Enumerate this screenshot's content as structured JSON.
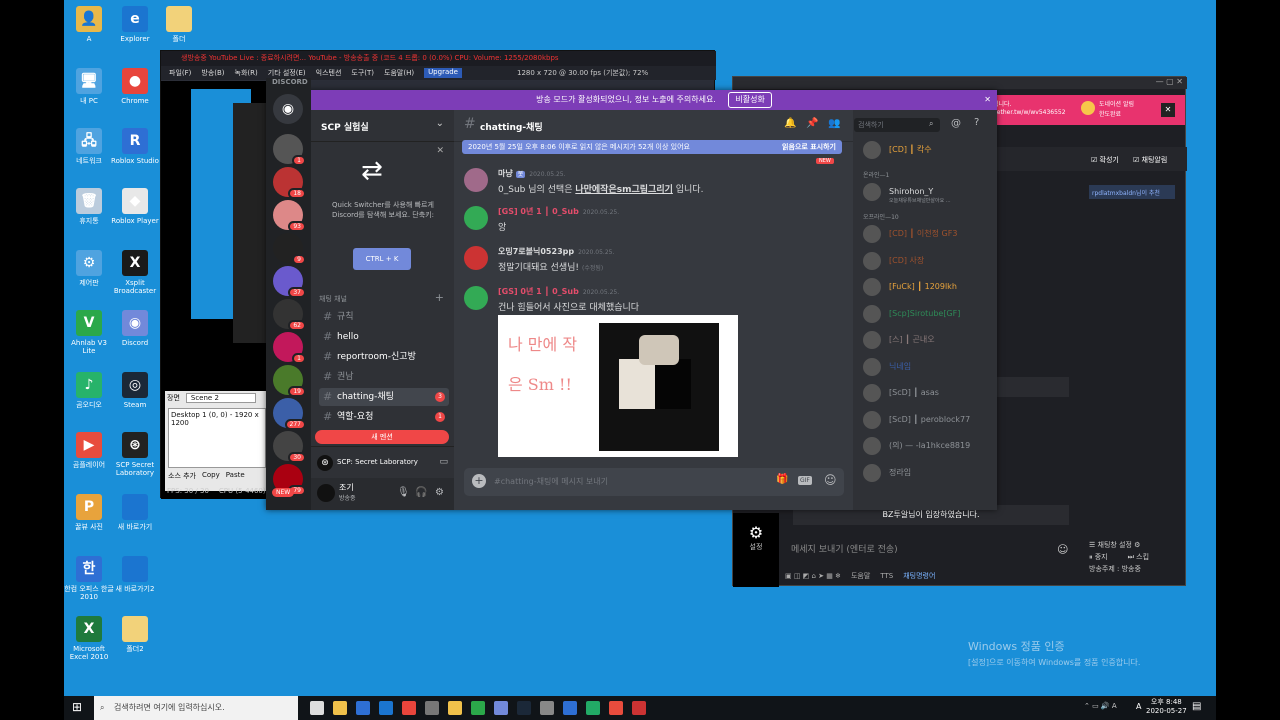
{
  "desktop_icons": [
    {
      "label": "A",
      "color": "#e8b84a",
      "glyph": "👤"
    },
    {
      "label": "Explorer",
      "color": "#1b75d0",
      "glyph": "e"
    },
    {
      "label": "폴더",
      "color": "#f2d27a",
      "glyph": ""
    },
    {
      "label": "내 PC",
      "color": "#4fa3e0",
      "glyph": "🖥"
    },
    {
      "label": "Chrome",
      "color": "#e8453c",
      "glyph": "●"
    },
    {
      "label": "네트워크",
      "color": "#4fa3e0",
      "glyph": "🖧"
    },
    {
      "label": "Roblox Studio",
      "color": "#2e6fd4",
      "glyph": "R"
    },
    {
      "label": "휴지통",
      "color": "#bcd",
      "glyph": "🗑"
    },
    {
      "label": "Roblox Player",
      "color": "#e8e8e8",
      "glyph": "◆"
    },
    {
      "label": "제어판",
      "color": "#4fa3e0",
      "glyph": "⚙"
    },
    {
      "label": "Xsplit Broadcaster",
      "color": "#1a1a1a",
      "glyph": "X"
    },
    {
      "label": "Ahnlab V3 Lite",
      "color": "#2ba84a",
      "glyph": "V"
    },
    {
      "label": "Discord",
      "color": "#7289da",
      "glyph": "◉"
    },
    {
      "label": "곰오디오",
      "color": "#27b36a",
      "glyph": "♪"
    },
    {
      "label": "Steam",
      "color": "#1b2838",
      "glyph": "◎"
    },
    {
      "label": "곰플레이어",
      "color": "#e84c3d",
      "glyph": "▶"
    },
    {
      "label": "SCP Secret Laboratory",
      "color": "#222",
      "glyph": "⊛"
    },
    {
      "label": "꿀뷰 사진",
      "color": "#e8a33c",
      "glyph": "P"
    },
    {
      "label": "새 바로가기",
      "color": "#1b75d0",
      "glyph": ""
    },
    {
      "label": "한컴 오피스 한글 2010",
      "color": "#2e6fd4",
      "glyph": "한"
    },
    {
      "label": "새 바로가기2",
      "color": "#1b75d0",
      "glyph": ""
    },
    {
      "label": "Microsoft Excel 2010",
      "color": "#1f7a3d",
      "glyph": "X"
    },
    {
      "label": "폴더2",
      "color": "#f2d27a",
      "glyph": ""
    }
  ],
  "obs": {
    "title": "생방송중   YouTube Live : 종료하시려면...   YouTube - 방송송출 중 (코드 4 드롭: 0 (0.0%)  CPU:  Volume: 1255/2080kbps",
    "menu": [
      "파일(F)",
      "방송(B)",
      "녹화(R)",
      "기타 설정(E)",
      "익스텐션",
      "도구(T)",
      "도움말(H)",
      "Upgrade"
    ],
    "resolution": "1280 x 720 @ 30.00 fps (기본값); 72%",
    "scene_label": "장면",
    "scene_name": "Scene 2",
    "source": "Desktop 1 (0, 0) - 1920 x 1200",
    "add_source": "소스 추가",
    "copy": "Copy",
    "paste": "Paste",
    "fps": "FPS: 30 / 30",
    "cpu": "CPU (5-4460)"
  },
  "discord": {
    "wordmark": "DISCORD",
    "banner": "방송 모드가 활성화되었으니, 정보 노출에 주의하세요.",
    "banner_button": "비활성화",
    "server_name": "SCP 실험실",
    "quick_switcher": "Quick Switcher를 사용해 빠르게 Discord를 탐색해 보세요. 단축키:",
    "shortcut": "CTRL + K",
    "category": "채팅 채널",
    "channels": [
      {
        "name": "규칙",
        "state": "read"
      },
      {
        "name": "hello",
        "state": "unread"
      },
      {
        "name": "reportroom-신고방",
        "state": "unread"
      },
      {
        "name": "권남",
        "state": "read"
      },
      {
        "name": "chatting-채팅",
        "state": "active",
        "badge": "3"
      },
      {
        "name": "역할-요청",
        "state": "unread",
        "badge": "1"
      }
    ],
    "new_mentions": "새 멘션",
    "voice_server": "SCP: Secret Laboratory",
    "user_name": "조기",
    "user_status": "방송중",
    "guild_badges": [
      "1",
      "18",
      "93",
      "9",
      "37",
      "62",
      "1",
      "19",
      "277",
      "30",
      "79"
    ],
    "guild_new": "NEW",
    "channel_title": "chatting-채팅",
    "search_placeholder": "검색하기",
    "unread_bar": "2020년 5월 25일 오후 8:06 이후로 읽지 않은 메시지가 52개 이상 있어요",
    "mark_read": "읽음으로 표시하기",
    "new_label": "NEW",
    "messages": [
      {
        "author": "마냥",
        "tag": "봇",
        "time": "2020.05.25.",
        "text_pre": "0_Sub 님의 선택은 ",
        "text_bold": "나만에작은sm그림그리기",
        "text_post": " 입니다.",
        "color": "#dcddde",
        "avatar": "#a06a8a"
      },
      {
        "author": "[GS] 0년 1 ┃ 0_Sub",
        "time": "2020.05.25.",
        "text": "앙",
        "color": "#e44d6b",
        "avatar": "#3a5"
      },
      {
        "author": "오밍7로볼닉0523pp",
        "time": "2020.05.25.",
        "text": "정말기대돼요 선생님!",
        "edited": "(수정됨)",
        "color": "#dcddde",
        "avatar": "#c33"
      },
      {
        "author": "[GS] 0년 1 ┃ 0_Sub",
        "time": "2020.05.25.",
        "text": "건나 힘들어서 사진으로 대체했습니다",
        "color": "#e44d6b",
        "avatar": "#3a5"
      }
    ],
    "drawing_text": "나 만에 작은 Sm !!",
    "input_placeholder": "#chatting-채팅에 메시지 보내기",
    "gif": "GIF",
    "member_sections": [
      {
        "title": "",
        "members": [
          {
            "name": "[CD] ┃ 칵수",
            "color": "#e8a33c"
          }
        ]
      },
      {
        "title": "온라인—1",
        "members": [
          {
            "name": "Shirohon_Y",
            "sub": "오늘채유튜브채널만살아요 ...",
            "color": "#dcddde"
          }
        ]
      },
      {
        "title": "오프라인—10",
        "members": [
          {
            "name": "[CD] ┃ 이천정 GF3",
            "color": "#a0522d"
          },
          {
            "name": "[CD] 사장",
            "color": "#a0522d"
          },
          {
            "name": "[FuCk] ┃ 1209lkh",
            "color": "#e8a33c"
          },
          {
            "name": "[Scp]Sirotube[GF]",
            "color": "#2e8b57"
          },
          {
            "name": "[스] ┃ 곤내오",
            "color": "#8a7a7a"
          },
          {
            "name": "닉네임",
            "color": "#3b5fa8"
          },
          {
            "name": "[ScD] ┃ asas",
            "color": "#8e9297"
          },
          {
            "name": "[ScD] ┃ peroblock77",
            "color": "#8e9297"
          },
          {
            "name": "(의) — -la1hkce8819",
            "color": "#8e9297"
          },
          {
            "name": "정라임",
            "color": "#8e9297"
          }
        ]
      }
    ]
  },
  "stream_panel": {
    "url": "gether.tw/w/wv5436552",
    "donate_label": "도네이션 알림",
    "donate_sub": "한도완료",
    "close": "✕",
    "tip": "됩니다.",
    "options": [
      "확성기",
      "채팅알림"
    ],
    "user_chip": "rpdlatmxbaldn님이 추천",
    "join_msg": "BZ투알님이 입장하였습니다.",
    "settings": "설정",
    "input_placeholder": "메세지 보내기 (엔터로 전송)",
    "chat_settings": "채팅창 설정",
    "stop": "중지",
    "skip": "스킵",
    "stream_user": "방송주제 : 방송중",
    "toolbar": [
      "도움말",
      "TTS",
      "채팅명령어"
    ]
  },
  "windows": {
    "activation_title": "Windows 정품 인증",
    "activation_sub": "[설정]으로 이동하여 Windows를 정품 인증합니다."
  },
  "taskbar": {
    "search_placeholder": "검색하려면 여기에 입력하십시오.",
    "time": "오후 8:48",
    "date": "2020-05-27",
    "lang": "A"
  }
}
